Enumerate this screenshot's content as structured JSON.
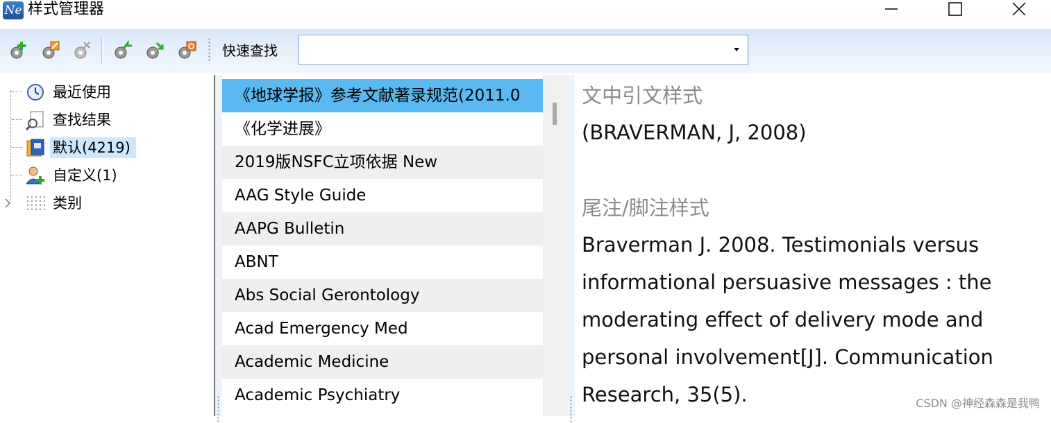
{
  "window": {
    "icon_text": "Ne",
    "title": "样式管理器"
  },
  "toolbar": {
    "icons": [
      "new-style-icon",
      "edit-style-icon",
      "delete-style-icon",
      "import-style-icon",
      "export-style-icon",
      "sync-style-icon"
    ],
    "search_label": "快速查找",
    "search_value": ""
  },
  "tree": {
    "items": [
      {
        "label": "最近使用",
        "icon": "clock-icon"
      },
      {
        "label": "查找结果",
        "icon": "search-document-icon"
      },
      {
        "label": "默认(4219)",
        "icon": "book-icon",
        "selected": true
      },
      {
        "label": "自定义(1)",
        "icon": "user-add-icon"
      },
      {
        "label": "类别",
        "icon": "grid-dots-icon",
        "expandable": true
      }
    ]
  },
  "style_list": {
    "items": [
      "《地球学报》参考文献著录规范(2011.0",
      "《化学进展》",
      "2019版NSFC立项依据 New",
      "AAG Style Guide",
      "AAPG Bulletin",
      "ABNT",
      "Abs Social Gerontology",
      "Acad Emergency Med",
      "Academic Medicine",
      "Academic Psychiatry"
    ],
    "selected_index": 0
  },
  "preview": {
    "intext_heading": "文中引文样式",
    "intext_example": "(BRAVERMAN, J, 2008)",
    "note_heading": "尾注/脚注样式",
    "note_example": "Braverman J. 2008. Testimonials versus informational persuasive messages : the moderating effect of delivery mode and personal involvement[J]. Communication Research, 35(5)."
  },
  "watermark": "CSDN @神经森森是我鸭"
}
